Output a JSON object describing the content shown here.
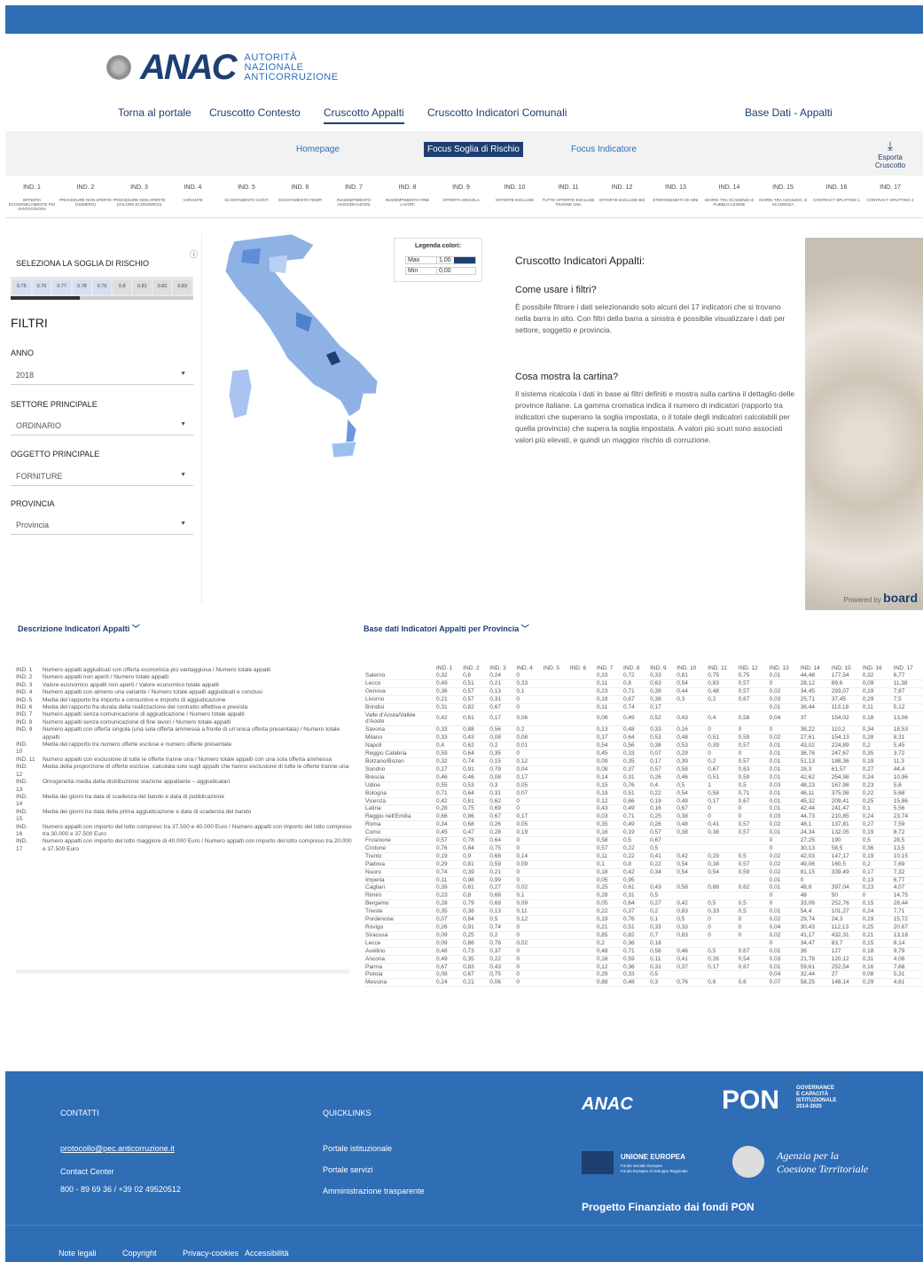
{
  "header": {
    "authority": [
      "AUTORITÀ",
      "NAZIONALE",
      "ANTICORRUZIONE"
    ]
  },
  "nav": {
    "items": [
      "Torna al portale",
      "Cruscotto Contesto",
      "Cruscotto Appalti",
      "Cruscotto Indicatori Comunali"
    ],
    "right": "Base Dati - Appalti"
  },
  "tabs": {
    "items": [
      "Homepage",
      "Focus Soglia di Rischio",
      "Focus Indicatore"
    ],
    "export": "Esporta Cruscotto"
  },
  "indicators": [
    {
      "n": "IND. 1",
      "d": "OFFERTA ECONOMICAMENTE PIÙ VANTAGGIOSA"
    },
    {
      "n": "IND. 2",
      "d": "PROCEDURE NON APERTE (NUMERO)"
    },
    {
      "n": "IND. 3",
      "d": "PROCEDURE NON APERTE (VALORE ECONOMICO)"
    },
    {
      "n": "IND. 4",
      "d": "VARIANTE"
    },
    {
      "n": "IND. 5",
      "d": "SCOSTAMENTO COSTI"
    },
    {
      "n": "IND. 6",
      "d": "SCOSTAMENTO TEMPI"
    },
    {
      "n": "IND. 7",
      "d": "INADEMPIMENTO AGGIUDICAZIONI"
    },
    {
      "n": "IND. 8",
      "d": "INADEMPIMENTO FINE LAVORI"
    },
    {
      "n": "IND. 9",
      "d": "OFFERTA SINGOLA"
    },
    {
      "n": "IND. 10",
      "d": "OFFERTE ESCLUSE"
    },
    {
      "n": "IND. 11",
      "d": "TUTTE OFFERTE ESCLUSE TRANNE UNA"
    },
    {
      "n": "IND. 12",
      "d": "OFFERTE ESCLUSE BIS"
    },
    {
      "n": "IND. 13",
      "d": "ETEROGENEITÀ DI SINI"
    },
    {
      "n": "IND. 14",
      "d": "GIORNI TRA SCADENZA E PUBBLICAZIONE"
    },
    {
      "n": "IND. 15",
      "d": "GIORNI TRA AGGIUDIC. E SCADENZA"
    },
    {
      "n": "IND. 16",
      "d": "CONTRACT SPLITTING 1"
    },
    {
      "n": "IND. 17",
      "d": "CONTRACT SPLITTING 2"
    }
  ],
  "left": {
    "threshold_title": "SELEZIONA LA SOGLIA DI RISCHIO",
    "thresholds": [
      "0.75",
      "0.76",
      "0.77",
      "0.78",
      "0.79",
      "0.8",
      "0.81",
      "0.82",
      "0.83"
    ],
    "filters_title": "FILTRI",
    "anno_label": "ANNO",
    "anno": "2018",
    "settore_label": "SETTORE PRINCIPALE",
    "settore": "ORDINARIO",
    "oggetto_label": "OGGETTO PRINCIPALE",
    "oggetto": "FORNITURE",
    "provincia_label": "PROVINCIA",
    "provincia": "Provincia"
  },
  "legend": {
    "title": "Legenda colori:",
    "max": "Max",
    "max_v": "1,00",
    "min": "Min",
    "min_v": "0,00"
  },
  "info": {
    "title": "Cruscotto Indicatori Appalti:",
    "h1": "Come usare i filtri?",
    "p1": "È possibile filtrare i dati selezionando solo alcuni dei 17 indicatori che si trovano nella barra in alto. Con filtri della barra a sinistra è possibile visualizzare i dati per settore, soggetto e provincia.",
    "h2": "Cosa mostra la cartina?",
    "p2": "Il sistema ricalcola i dati in base ai filtri definiti e mostra sulla cartina il dettaglio delle province italiane. La gamma cromatica indica il numero di indicatori (rapporto tra indicatori che superano la soglia impostata, o il totale degli indicatori calcolabili per quella provincia) che supera la soglia impostata. A valori più scuri sono associati valori più elevati, e quindi un maggior rischio di corruzione.",
    "powered": "Powered by",
    "board": "board"
  },
  "sections": {
    "desc": "Descrizione Indicatori Appalti",
    "db": "Base dati Indicatori Appalti per Provincia"
  },
  "desc_rows": [
    [
      "IND. 1",
      "Numero appalti aggiudicati con offerta economica più vantaggiosa / Numero totale appalti"
    ],
    [
      "IND. 2",
      "Numero appalti non aperti / Numero totale appalti"
    ],
    [
      "IND. 3",
      "Valore economico appalti non aperti / Valore economico totale appalti"
    ],
    [
      "IND. 4",
      "Numero appalti con almeno una variante / Numero totale appalti aggiudicati e conclusi"
    ],
    [
      "IND. 5",
      "Media del rapporto fra importo a consuntivo e importo di aggiudicazione"
    ],
    [
      "IND. 6",
      "Media del rapporto fra durata della realizzazione del contratto effettiva e prevista"
    ],
    [
      "IND. 7",
      "Numero appalti senza comunicazione di aggiudicazione / Numero totale appalti"
    ],
    [
      "IND. 8",
      "Numero appalti senza comunicazione di fine lavori / Numero totale appalti"
    ],
    [
      "IND. 9",
      "Numero appalti con offerta singola (una sola offerta ammessa a fronte di un'unica offerta presentata) / Numero totale appalti"
    ],
    [
      "IND. 10",
      "Media del rapporto tra numero offerte escluse e numero offerte presentate"
    ],
    [
      "IND. 11",
      "Numero appalti con esclusione di tutte le offerte tranne una / Numero totale appalti con una sola offerta ammessa"
    ],
    [
      "IND. 12",
      "Media della proporzione di offerte escluse, calcolata solo sugli appalti che hanno esclusione di tutte le offerte tranne una"
    ],
    [
      "IND. 13",
      "Omogeneità media della distribuzione stazione appaltante – aggiudicatari"
    ],
    [
      "IND. 14",
      "Media dei giorni tra data di scadenza del bando e data di pubblicazione"
    ],
    [
      "IND. 15",
      "Media dei giorni tra data della prima aggiudicazione e data di scadenza del bando"
    ],
    [
      "IND. 16",
      "Numero appalti con importo del lotto compreso tra 37.500 e 40.000 Euro / Numero appalti con importo del lotto compreso tra 30.000 e 37.500 Euro"
    ],
    [
      "IND. 17",
      "Numero appalti con importo del lotto maggiore di 40.000 Euro / Numero appalti con importo del lotto compreso tra 20.000 e 37.500 Euro"
    ]
  ],
  "table": {
    "cols": [
      "IND. 1",
      "IND. 2",
      "IND. 3",
      "IND. 4",
      "IND. 5",
      "IND. 6",
      "IND. 7",
      "IND. 8",
      "IND. 9",
      "IND. 10",
      "IND. 11",
      "IND. 12",
      "IND. 13",
      "IND. 14",
      "IND. 15",
      "IND. 16",
      "IND. 17"
    ],
    "rows": [
      [
        "Salerno",
        "0,32",
        "0,6",
        "0,24",
        "0",
        "",
        "",
        "0,33",
        "0,72",
        "0,33",
        "0,81",
        "0,75",
        "0,75",
        "0,01",
        "44,48",
        "177,54",
        "0,32",
        "6,77"
      ],
      [
        "Lecco",
        "0,49",
        "0,51",
        "0,21",
        "0,33",
        "",
        "",
        "0,11",
        "0,8",
        "0,63",
        "0,54",
        "0,83",
        "0,57",
        "0",
        "28,12",
        "89,6",
        "0,09",
        "11,38"
      ],
      [
        "Genova",
        "0,36",
        "0,57",
        "0,13",
        "0,1",
        "",
        "",
        "0,23",
        "0,71",
        "0,39",
        "0,44",
        "0,48",
        "0,57",
        "0,02",
        "34,45",
        "293,07",
        "0,19",
        "7,87"
      ],
      [
        "Livorno",
        "0,21",
        "0,57",
        "0,31",
        "0",
        "",
        "",
        "0,18",
        "0,67",
        "0,38",
        "0,3",
        "0,2",
        "0,67",
        "0,03",
        "25,71",
        "37,45",
        "0,29",
        "7,5"
      ],
      [
        "Brindisi",
        "0,31",
        "0,82",
        "0,67",
        "0",
        "",
        "",
        "0,11",
        "0,74",
        "0,17",
        "",
        "",
        "",
        "0,01",
        "36,44",
        "113,18",
        "0,11",
        "5,12"
      ],
      [
        "Valle d'Aosta/Vallée d'Aoste",
        "0,42",
        "0,61",
        "0,17",
        "0,06",
        "",
        "",
        "0,08",
        "0,49",
        "0,52",
        "0,43",
        "0,4",
        "0,58",
        "0,04",
        "37",
        "154,02",
        "0,18",
        "13,06"
      ],
      [
        "Savona",
        "0,33",
        "0,88",
        "0,56",
        "0,2",
        "",
        "",
        "0,13",
        "0,48",
        "0,33",
        "0,16",
        "0",
        "0",
        "0",
        "38,22",
        "110,2",
        "0,34",
        "18,53"
      ],
      [
        "Milano",
        "0,33",
        "0,43",
        "0,08",
        "0,08",
        "",
        "",
        "0,17",
        "0,64",
        "0,53",
        "0,48",
        "0,51",
        "0,59",
        "0,02",
        "27,61",
        "154,13",
        "0,28",
        "8,31"
      ],
      [
        "Napoli",
        "0,4",
        "0,62",
        "0,2",
        "0,01",
        "",
        "",
        "0,54",
        "0,56",
        "0,38",
        "0,53",
        "0,39",
        "0,57",
        "0,01",
        "43,02",
        "224,89",
        "0,2",
        "5,45"
      ],
      [
        "Reggio Calabria",
        "0,59",
        "0,64",
        "0,35",
        "0",
        "",
        "",
        "0,45",
        "0,33",
        "0,07",
        "0,29",
        "0",
        "0",
        "0,01",
        "36,76",
        "247,67",
        "0,35",
        "3,72"
      ],
      [
        "Bolzano/Bozen",
        "0,32",
        "0,74",
        "0,15",
        "0,12",
        "",
        "",
        "0,09",
        "0,35",
        "0,17",
        "0,39",
        "0,2",
        "0,57",
        "0,01",
        "51,13",
        "188,36",
        "0,19",
        "11,3"
      ],
      [
        "Sondrio",
        "0,17",
        "0,91",
        "0,79",
        "0,04",
        "",
        "",
        "0,08",
        "0,37",
        "0,57",
        "0,58",
        "0,67",
        "0,63",
        "0,01",
        "28,3",
        "61,57",
        "0,27",
        "44,4"
      ],
      [
        "Brescia",
        "0,46",
        "0,46",
        "0,08",
        "0,17",
        "",
        "",
        "0,14",
        "0,31",
        "0,26",
        "0,46",
        "0,51",
        "0,59",
        "0,01",
        "42,62",
        "254,98",
        "0,24",
        "10,96"
      ],
      [
        "Udine",
        "0,55",
        "0,53",
        "0,3",
        "0,05",
        "",
        "",
        "0,15",
        "0,76",
        "0,4",
        "0,5",
        "1",
        "0,5",
        "0,03",
        "48,23",
        "167,98",
        "0,23",
        "5,6"
      ],
      [
        "Bologna",
        "0,71",
        "0,64",
        "0,31",
        "0,07",
        "",
        "",
        "0,19",
        "0,51",
        "0,22",
        "0,54",
        "0,58",
        "0,71",
        "0,01",
        "46,11",
        "375,98",
        "0,22",
        "5,68"
      ],
      [
        "Vicenza",
        "0,42",
        "0,81",
        "0,62",
        "0",
        "",
        "",
        "0,12",
        "0,66",
        "0,19",
        "0,49",
        "0,17",
        "0,67",
        "0,01",
        "45,32",
        "209,41",
        "0,25",
        "15,86"
      ],
      [
        "Latina",
        "0,28",
        "0,75",
        "0,69",
        "0",
        "",
        "",
        "0,43",
        "0,49",
        "0,16",
        "0,67",
        "0",
        "0",
        "0,01",
        "42,44",
        "241,47",
        "0,1",
        "5,56"
      ],
      [
        "Reggio nell'Emilia",
        "0,66",
        "0,86",
        "0,67",
        "0,17",
        "",
        "",
        "0,03",
        "0,71",
        "0,25",
        "0,38",
        "0",
        "0",
        "0,03",
        "44,73",
        "210,85",
        "0,24",
        "23,74"
      ],
      [
        "Roma",
        "0,34",
        "0,68",
        "0,26",
        "0,05",
        "",
        "",
        "0,35",
        "0,49",
        "0,26",
        "0,48",
        "0,41",
        "0,57",
        "0,02",
        "48,1",
        "137,81",
        "0,27",
        "7,59"
      ],
      [
        "Como",
        "0,45",
        "0,47",
        "0,28",
        "0,19",
        "",
        "",
        "0,16",
        "0,19",
        "0,57",
        "0,38",
        "0,38",
        "0,57",
        "0,01",
        "24,34",
        "132,05",
        "0,19",
        "8,72"
      ],
      [
        "Frosinone",
        "0,57",
        "0,78",
        "0,64",
        "0",
        "",
        "",
        "0,58",
        "0,5",
        "0,67",
        "",
        "",
        "",
        "0",
        "27,25",
        "190",
        "0,5",
        "28,5"
      ],
      [
        "Crotone",
        "0,76",
        "0,84",
        "0,75",
        "0",
        "",
        "",
        "0,57",
        "0,22",
        "0,5",
        "",
        "",
        "",
        "0",
        "30,13",
        "58,5",
        "0,36",
        "13,5"
      ],
      [
        "Trento",
        "0,19",
        "0,9",
        "0,68",
        "0,14",
        "",
        "",
        "0,11",
        "0,22",
        "0,41",
        "0,42",
        "0,29",
        "0,5",
        "0,02",
        "42,03",
        "147,17",
        "0,19",
        "10,15"
      ],
      [
        "Padova",
        "0,29",
        "0,81",
        "0,59",
        "0,09",
        "",
        "",
        "0,1",
        "0,8",
        "0,22",
        "0,54",
        "0,38",
        "0,57",
        "0,02",
        "49,06",
        "160,5",
        "0,2",
        "7,69"
      ],
      [
        "Nuoro",
        "0,74",
        "0,39",
        "0,21",
        "0",
        "",
        "",
        "0,18",
        "0,42",
        "0,34",
        "0,54",
        "0,54",
        "0,59",
        "0,02",
        "81,15",
        "339,49",
        "0,17",
        "7,32"
      ],
      [
        "Imperia",
        "0,11",
        "0,98",
        "0,99",
        "0",
        "",
        "",
        "0,05",
        "0,95",
        "",
        "",
        "",
        "",
        "0,01",
        "0",
        "",
        "0,13",
        "6,77"
      ],
      [
        "Cagliari",
        "0,39",
        "0,61",
        "0,27",
        "0,02",
        "",
        "",
        "0,25",
        "0,61",
        "0,43",
        "0,58",
        "0,88",
        "0,62",
        "0,01",
        "48,8",
        "397,04",
        "0,23",
        "4,07"
      ],
      [
        "Rimini",
        "0,23",
        "0,8",
        "0,68",
        "0,1",
        "",
        "",
        "0,28",
        "0,31",
        "0,5",
        "",
        "",
        "",
        "0",
        "48",
        "50",
        "0",
        "14,75"
      ],
      [
        "Bergamo",
        "0,28",
        "0,79",
        "0,69",
        "0,09",
        "",
        "",
        "0,05",
        "0,64",
        "0,27",
        "0,42",
        "0,5",
        "0,5",
        "0",
        "33,06",
        "252,76",
        "0,15",
        "28,44"
      ],
      [
        "Trieste",
        "0,35",
        "0,38",
        "0,13",
        "0,11",
        "",
        "",
        "0,22",
        "0,37",
        "0,2",
        "0,83",
        "0,33",
        "0,5",
        "0,01",
        "54,4",
        "101,27",
        "0,24",
        "7,71"
      ],
      [
        "Pordenone",
        "0,07",
        "0,84",
        "0,5",
        "0,12",
        "",
        "",
        "0,19",
        "0,76",
        "0,1",
        "0,5",
        "0",
        "0",
        "0,02",
        "29,74",
        "24,3",
        "0,19",
        "15,72"
      ],
      [
        "Rovigo",
        "0,26",
        "0,91",
        "0,74",
        "0",
        "",
        "",
        "0,21",
        "0,51",
        "0,33",
        "0,33",
        "0",
        "0",
        "0,04",
        "30,43",
        "112,13",
        "0,25",
        "20,67"
      ],
      [
        "Siracusa",
        "0,09",
        "0,25",
        "0,2",
        "0",
        "",
        "",
        "0,85",
        "0,82",
        "0,7",
        "0,83",
        "0",
        "0",
        "0,02",
        "41,17",
        "432,31",
        "0,21",
        "13,18"
      ],
      [
        "Lecce",
        "0,09",
        "0,86",
        "0,76",
        "0,02",
        "",
        "",
        "0,2",
        "0,36",
        "0,18",
        "",
        "",
        "",
        "0",
        "34,47",
        "83,7",
        "0,15",
        "8,14"
      ],
      [
        "Avellino",
        "0,48",
        "0,73",
        "0,37",
        "0",
        "",
        "",
        "0,48",
        "0,71",
        "0,56",
        "0,46",
        "0,5",
        "0,67",
        "0,01",
        "36",
        "127",
        "0,18",
        "9,79"
      ],
      [
        "Ancona",
        "0,49",
        "0,35",
        "0,22",
        "0",
        "",
        "",
        "0,16",
        "0,59",
        "0,11",
        "0,41",
        "0,26",
        "0,54",
        "0,03",
        "21,78",
        "120,12",
        "0,31",
        "4,08"
      ],
      [
        "Parma",
        "0,67",
        "0,83",
        "0,43",
        "0",
        "",
        "",
        "0,12",
        "0,36",
        "0,31",
        "0,37",
        "0,17",
        "0,67",
        "0,01",
        "59,61",
        "252,54",
        "0,16",
        "7,68"
      ],
      [
        "Pistoia",
        "0,08",
        "0,67",
        "0,75",
        "0",
        "",
        "",
        "0,29",
        "0,33",
        "0,5",
        "",
        "",
        "",
        "0,04",
        "32,44",
        "27",
        "0,08",
        "5,31"
      ],
      [
        "Messina",
        "0,24",
        "0,21",
        "0,06",
        "0",
        "",
        "",
        "0,88",
        "0,48",
        "0,3",
        "0,76",
        "0,6",
        "0,6",
        "0,07",
        "58,25",
        "148,14",
        "0,29",
        "4,81"
      ]
    ]
  },
  "footer": {
    "contatti": "CONTATTI",
    "email": "protocollo@pec.anticorruzione.it",
    "contact_center": "Contact Center",
    "phone": "800 - 89 69 36 / +39 02 49520512",
    "quicklinks": "QUICKLINKS",
    "ql": [
      "Portale istituzionale",
      "Portale servizi",
      "Amministrazione trasparente"
    ],
    "pon": "PON",
    "pon_sub": [
      "GOVERNANCE",
      "E CAPACITÀ",
      "ISTITUZIONALE",
      "2014-2020"
    ],
    "ue": "UNIONE EUROPEA",
    "ue_sub": [
      "Fondo Sociale Europeo",
      "Fondo Europeo di Sviluppo Regionale"
    ],
    "agenzia": [
      "Agenzia per la",
      "Coesione Territoriale"
    ],
    "progetto": "Progetto Finanziato dai fondi PON",
    "bottom": [
      "Note legali",
      "Copyright",
      "Privacy-cookies",
      "Accessibilità"
    ]
  },
  "colors": {
    "primary": "#2f6db5",
    "dark": "#1d3f72"
  }
}
